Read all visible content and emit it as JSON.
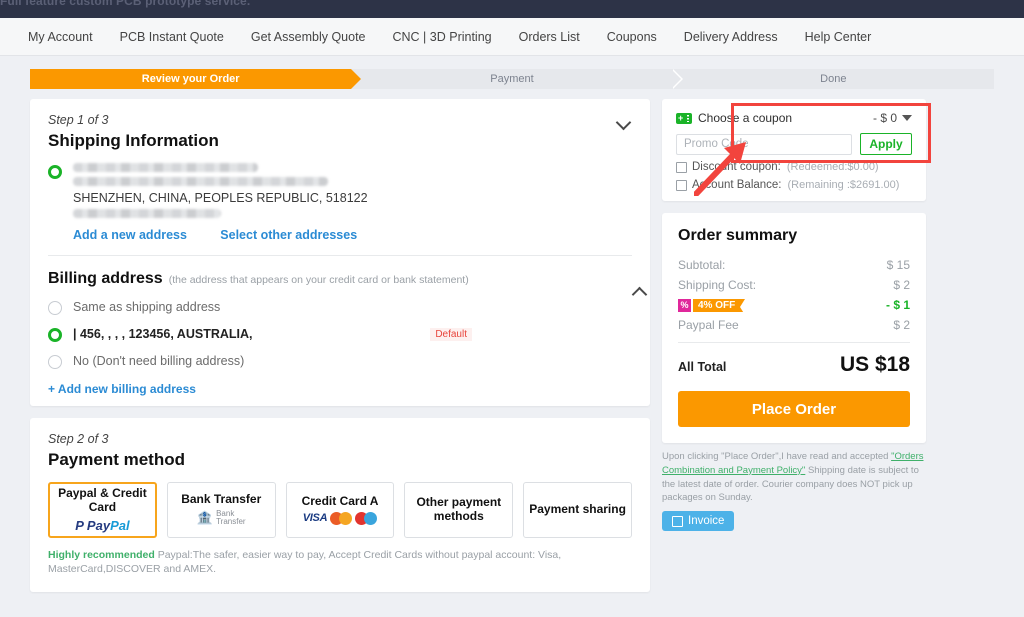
{
  "topbar": {
    "tagline": "Full feature custom PCB prototype service."
  },
  "nav": {
    "items": [
      {
        "label": "My Account"
      },
      {
        "label": "PCB Instant Quote"
      },
      {
        "label": "Get Assembly Quote"
      },
      {
        "label": "CNC | 3D Printing"
      },
      {
        "label": "Orders List"
      },
      {
        "label": "Coupons"
      },
      {
        "label": "Delivery Address"
      },
      {
        "label": "Help Center"
      }
    ]
  },
  "progress": {
    "steps": [
      {
        "label": "Review your Order",
        "state": "active"
      },
      {
        "label": "Payment",
        "state": "inactive"
      },
      {
        "label": "Done",
        "state": "inactive"
      }
    ]
  },
  "shipping": {
    "step_label": "Step 1 of 3",
    "title": "Shipping Information",
    "address_line_visible": "SHENZHEN, CHINA, PEOPLES REPUBLIC, 518122",
    "add_new_address": "Add a new address",
    "select_other_addresses": "Select other addresses"
  },
  "billing": {
    "title": "Billing address",
    "note": "(the address that appears on your credit card or bank statement)",
    "options": [
      {
        "label": "Same as shipping address",
        "selected": false,
        "tag": ""
      },
      {
        "label": "| 456, , , , 123456, AUSTRALIA,",
        "selected": true,
        "tag": "Default"
      },
      {
        "label": "No  (Don't need billing address)",
        "selected": false,
        "tag": ""
      }
    ],
    "add_new": "+ Add new billing address"
  },
  "payment": {
    "step_label": "Step 2 of 3",
    "title": "Payment method",
    "methods": [
      {
        "title": "Paypal & Credit Card",
        "brand": "PayPal",
        "selected": true
      },
      {
        "title": "Bank Transfer",
        "brand": "Bank Transfer",
        "selected": false
      },
      {
        "title": "Credit Card A",
        "brand": "VISA",
        "selected": false
      },
      {
        "title": "Other payment methods",
        "brand": "",
        "selected": false
      },
      {
        "title": "Payment sharing",
        "brand": "",
        "selected": false
      }
    ],
    "footnote_strong": "Highly recommended",
    "footnote": " Paypal:The safer, easier way to pay, Accept Credit Cards without paypal account: Visa, MasterCard,DISCOVER and AMEX."
  },
  "coupon": {
    "choose_label": "Choose a coupon",
    "amount": "- $ 0",
    "promo_placeholder": "Promo Code",
    "promo_value": "",
    "apply_label": "Apply",
    "discount_coupon_label": "Discount coupon:",
    "discount_coupon_note": "(Redeemed:$0.00)",
    "account_balance_label": "Account Balance:",
    "account_balance_note": "(Remaining :$2691.00)"
  },
  "summary": {
    "title": "Order summary",
    "rows": [
      {
        "key": "Subtotal:",
        "value": "$ 15"
      },
      {
        "key": "Shipping Cost:",
        "value": "$ 2"
      },
      {
        "key": "4% OFF",
        "value": "- $ 1"
      },
      {
        "key": "Paypal Fee",
        "value": "$ 2"
      }
    ],
    "total_label": "All Total",
    "total_value": "US $18",
    "place_order": "Place Order",
    "terms_pre": "Upon clicking \"Place Order\",I have read and accepted ",
    "terms_link": "\"Orders Combination and Payment Policy\"",
    "terms_post": " Shipping date is subject to the latest date of order. Courier company does NOT pick up packages on Sunday.",
    "invoice_label": "Invoice"
  },
  "colors": {
    "accent_orange": "#fb9800",
    "green": "#1ab328",
    "link_blue": "#2b8bd4",
    "annotation_red": "#f2443d",
    "dark_header": "#2d3347"
  }
}
